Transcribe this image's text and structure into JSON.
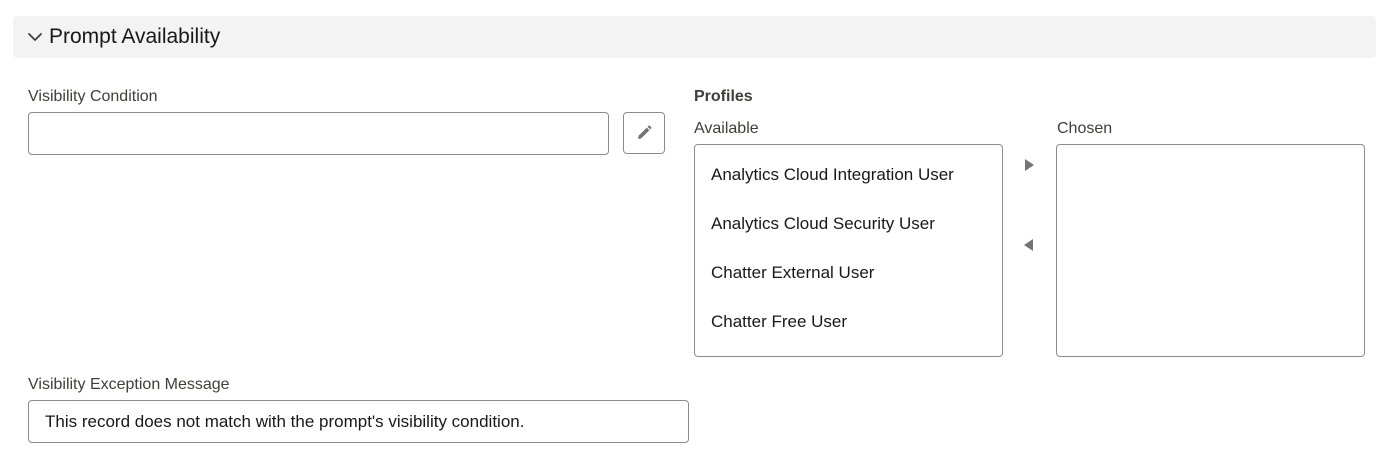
{
  "section": {
    "title": "Prompt Availability",
    "chevron_icon": "chevron-down-icon"
  },
  "visibility_condition": {
    "label": "Visibility Condition",
    "value": "",
    "edit_icon": "pencil-icon"
  },
  "profiles": {
    "label": "Profiles",
    "available_label": "Available",
    "chosen_label": "Chosen",
    "available_items": [
      "Analytics Cloud Integration User",
      "Analytics Cloud Security User",
      "Chatter External User",
      "Chatter Free User"
    ],
    "chosen_items": [],
    "move_right_icon": "triangle-right-icon",
    "move_left_icon": "triangle-left-icon"
  },
  "visibility_exception": {
    "label": "Visibility Exception Message",
    "value": "This record does not match with the prompt's visibility condition."
  },
  "colors": {
    "header_bg": "#f3f3f3",
    "border": "#8c8c8c",
    "label_text": "#3e3e3c",
    "icon": "#747474"
  }
}
